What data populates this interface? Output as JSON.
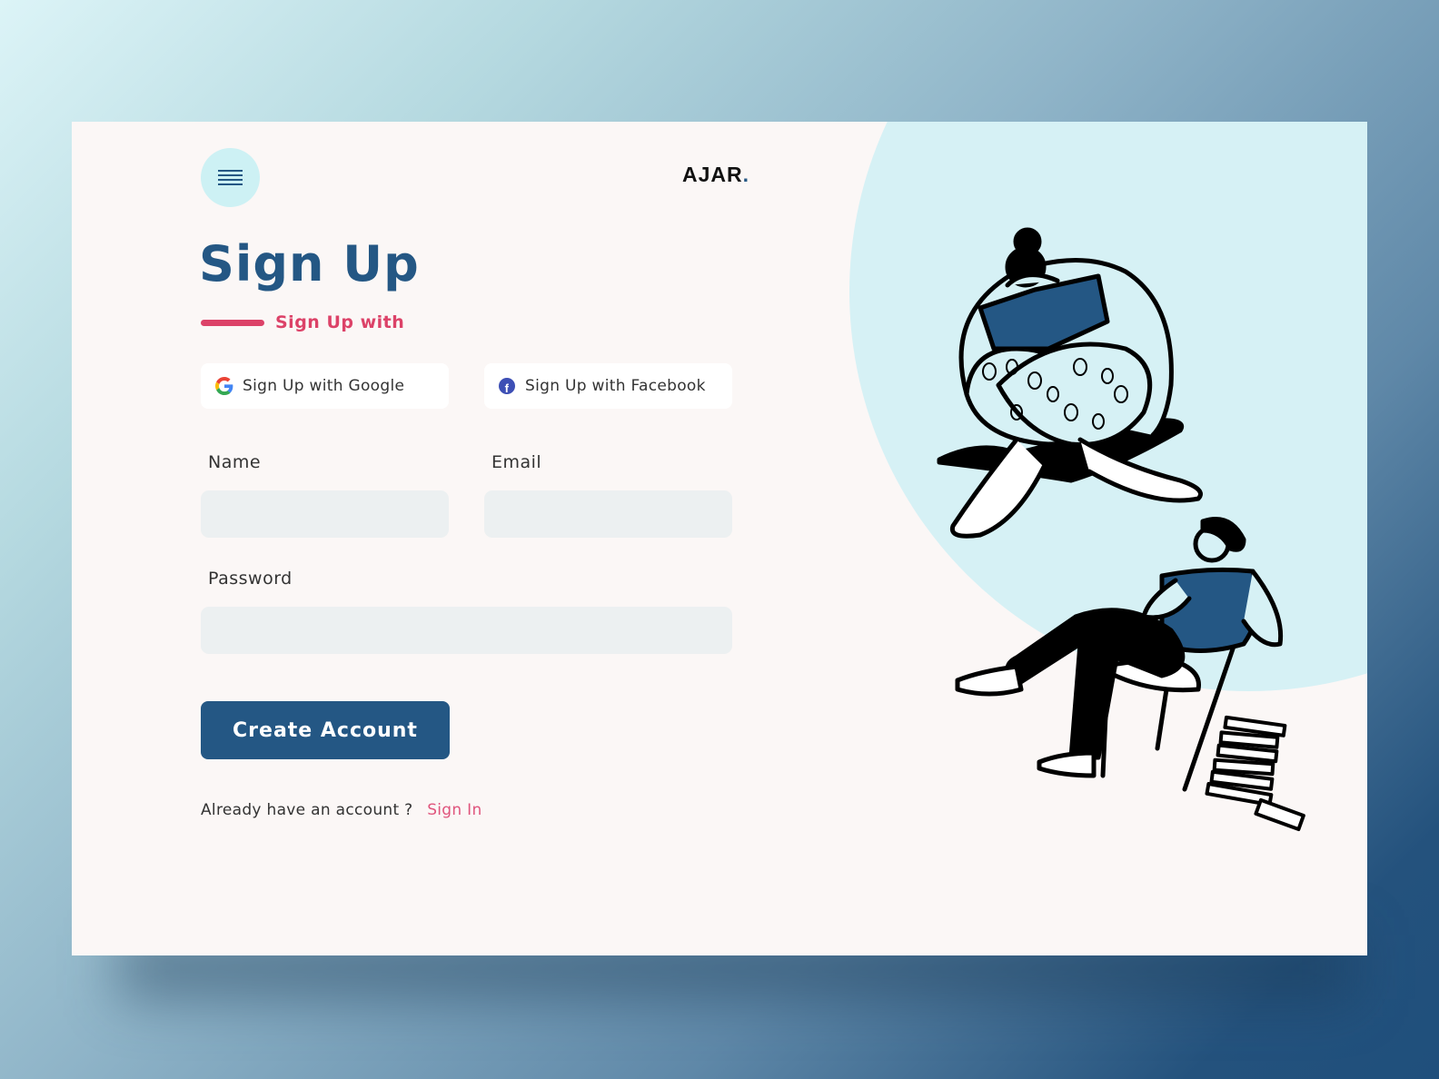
{
  "brand": {
    "name": "AJAR",
    "dot": "."
  },
  "header": {
    "menu_icon": "hamburger-menu-icon"
  },
  "page": {
    "title": "Sign Up",
    "subtitle": "Sign Up with"
  },
  "social": {
    "google": {
      "label": "Sign Up with Google",
      "icon": "google-icon"
    },
    "facebook": {
      "label": "Sign Up with Facebook",
      "icon": "facebook-icon",
      "icon_glyph": "f"
    }
  },
  "form": {
    "name": {
      "label": "Name",
      "value": "",
      "placeholder": ""
    },
    "email": {
      "label": "Email",
      "value": "",
      "placeholder": ""
    },
    "password": {
      "label": "Password",
      "value": "",
      "placeholder": ""
    },
    "submit_label": "Create Account"
  },
  "footer": {
    "prompt": "Already have an account ?",
    "signin_link": "Sign In"
  },
  "colors": {
    "primary": "#245784",
    "accent": "#dc4268",
    "link": "#e0557d",
    "card_bg": "#fbf7f6",
    "illustration_bg": "#d6f1f5",
    "input_bg": "#ecf0f1"
  },
  "illustration": {
    "description": "Two people reading books: one sitting cross-legged, one leaning back in a chair beside a stack of books"
  }
}
